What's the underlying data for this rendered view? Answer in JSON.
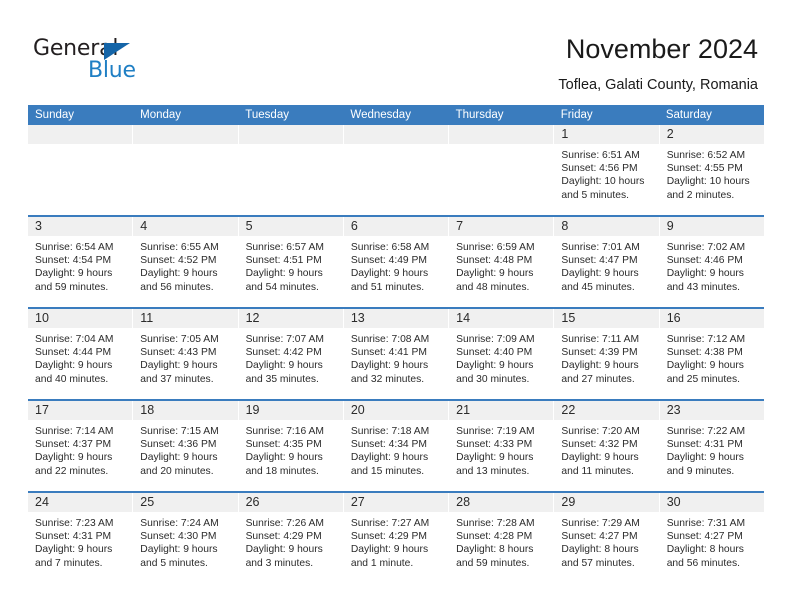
{
  "brand": {
    "name_part1": "General",
    "name_part2": "Blue",
    "triangle_color": "#1565a8",
    "blue_color": "#1f7fc4"
  },
  "header": {
    "title": "November 2024",
    "subtitle": "Toflea, Galati County, Romania"
  },
  "calendar": {
    "header_bg": "#3a7cbe",
    "daynum_bg": "#f0f0f0",
    "weekdays": [
      "Sunday",
      "Monday",
      "Tuesday",
      "Wednesday",
      "Thursday",
      "Friday",
      "Saturday"
    ],
    "weeks": [
      {
        "days": [
          {
            "num": "",
            "lines": []
          },
          {
            "num": "",
            "lines": []
          },
          {
            "num": "",
            "lines": []
          },
          {
            "num": "",
            "lines": []
          },
          {
            "num": "",
            "lines": []
          },
          {
            "num": "1",
            "lines": [
              "Sunrise: 6:51 AM",
              "Sunset: 4:56 PM",
              "Daylight: 10 hours",
              "and 5 minutes."
            ]
          },
          {
            "num": "2",
            "lines": [
              "Sunrise: 6:52 AM",
              "Sunset: 4:55 PM",
              "Daylight: 10 hours",
              "and 2 minutes."
            ]
          }
        ]
      },
      {
        "days": [
          {
            "num": "3",
            "lines": [
              "Sunrise: 6:54 AM",
              "Sunset: 4:54 PM",
              "Daylight: 9 hours",
              "and 59 minutes."
            ]
          },
          {
            "num": "4",
            "lines": [
              "Sunrise: 6:55 AM",
              "Sunset: 4:52 PM",
              "Daylight: 9 hours",
              "and 56 minutes."
            ]
          },
          {
            "num": "5",
            "lines": [
              "Sunrise: 6:57 AM",
              "Sunset: 4:51 PM",
              "Daylight: 9 hours",
              "and 54 minutes."
            ]
          },
          {
            "num": "6",
            "lines": [
              "Sunrise: 6:58 AM",
              "Sunset: 4:49 PM",
              "Daylight: 9 hours",
              "and 51 minutes."
            ]
          },
          {
            "num": "7",
            "lines": [
              "Sunrise: 6:59 AM",
              "Sunset: 4:48 PM",
              "Daylight: 9 hours",
              "and 48 minutes."
            ]
          },
          {
            "num": "8",
            "lines": [
              "Sunrise: 7:01 AM",
              "Sunset: 4:47 PM",
              "Daylight: 9 hours",
              "and 45 minutes."
            ]
          },
          {
            "num": "9",
            "lines": [
              "Sunrise: 7:02 AM",
              "Sunset: 4:46 PM",
              "Daylight: 9 hours",
              "and 43 minutes."
            ]
          }
        ]
      },
      {
        "days": [
          {
            "num": "10",
            "lines": [
              "Sunrise: 7:04 AM",
              "Sunset: 4:44 PM",
              "Daylight: 9 hours",
              "and 40 minutes."
            ]
          },
          {
            "num": "11",
            "lines": [
              "Sunrise: 7:05 AM",
              "Sunset: 4:43 PM",
              "Daylight: 9 hours",
              "and 37 minutes."
            ]
          },
          {
            "num": "12",
            "lines": [
              "Sunrise: 7:07 AM",
              "Sunset: 4:42 PM",
              "Daylight: 9 hours",
              "and 35 minutes."
            ]
          },
          {
            "num": "13",
            "lines": [
              "Sunrise: 7:08 AM",
              "Sunset: 4:41 PM",
              "Daylight: 9 hours",
              "and 32 minutes."
            ]
          },
          {
            "num": "14",
            "lines": [
              "Sunrise: 7:09 AM",
              "Sunset: 4:40 PM",
              "Daylight: 9 hours",
              "and 30 minutes."
            ]
          },
          {
            "num": "15",
            "lines": [
              "Sunrise: 7:11 AM",
              "Sunset: 4:39 PM",
              "Daylight: 9 hours",
              "and 27 minutes."
            ]
          },
          {
            "num": "16",
            "lines": [
              "Sunrise: 7:12 AM",
              "Sunset: 4:38 PM",
              "Daylight: 9 hours",
              "and 25 minutes."
            ]
          }
        ]
      },
      {
        "days": [
          {
            "num": "17",
            "lines": [
              "Sunrise: 7:14 AM",
              "Sunset: 4:37 PM",
              "Daylight: 9 hours",
              "and 22 minutes."
            ]
          },
          {
            "num": "18",
            "lines": [
              "Sunrise: 7:15 AM",
              "Sunset: 4:36 PM",
              "Daylight: 9 hours",
              "and 20 minutes."
            ]
          },
          {
            "num": "19",
            "lines": [
              "Sunrise: 7:16 AM",
              "Sunset: 4:35 PM",
              "Daylight: 9 hours",
              "and 18 minutes."
            ]
          },
          {
            "num": "20",
            "lines": [
              "Sunrise: 7:18 AM",
              "Sunset: 4:34 PM",
              "Daylight: 9 hours",
              "and 15 minutes."
            ]
          },
          {
            "num": "21",
            "lines": [
              "Sunrise: 7:19 AM",
              "Sunset: 4:33 PM",
              "Daylight: 9 hours",
              "and 13 minutes."
            ]
          },
          {
            "num": "22",
            "lines": [
              "Sunrise: 7:20 AM",
              "Sunset: 4:32 PM",
              "Daylight: 9 hours",
              "and 11 minutes."
            ]
          },
          {
            "num": "23",
            "lines": [
              "Sunrise: 7:22 AM",
              "Sunset: 4:31 PM",
              "Daylight: 9 hours",
              "and 9 minutes."
            ]
          }
        ]
      },
      {
        "days": [
          {
            "num": "24",
            "lines": [
              "Sunrise: 7:23 AM",
              "Sunset: 4:31 PM",
              "Daylight: 9 hours",
              "and 7 minutes."
            ]
          },
          {
            "num": "25",
            "lines": [
              "Sunrise: 7:24 AM",
              "Sunset: 4:30 PM",
              "Daylight: 9 hours",
              "and 5 minutes."
            ]
          },
          {
            "num": "26",
            "lines": [
              "Sunrise: 7:26 AM",
              "Sunset: 4:29 PM",
              "Daylight: 9 hours",
              "and 3 minutes."
            ]
          },
          {
            "num": "27",
            "lines": [
              "Sunrise: 7:27 AM",
              "Sunset: 4:29 PM",
              "Daylight: 9 hours",
              "and 1 minute."
            ]
          },
          {
            "num": "28",
            "lines": [
              "Sunrise: 7:28 AM",
              "Sunset: 4:28 PM",
              "Daylight: 8 hours",
              "and 59 minutes."
            ]
          },
          {
            "num": "29",
            "lines": [
              "Sunrise: 7:29 AM",
              "Sunset: 4:27 PM",
              "Daylight: 8 hours",
              "and 57 minutes."
            ]
          },
          {
            "num": "30",
            "lines": [
              "Sunrise: 7:31 AM",
              "Sunset: 4:27 PM",
              "Daylight: 8 hours",
              "and 56 minutes."
            ]
          }
        ]
      }
    ]
  }
}
